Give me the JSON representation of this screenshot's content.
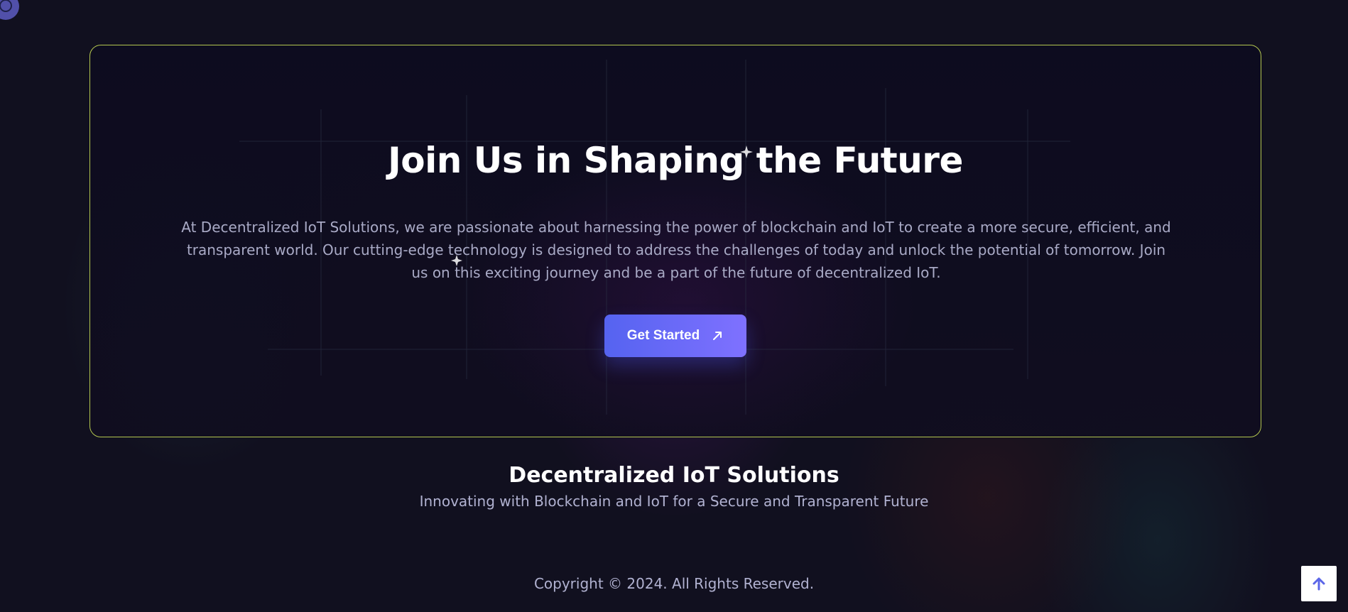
{
  "cta": {
    "title": "Join Us in Shaping the Future",
    "description": "At Decentralized IoT Solutions, we are passionate about harnessing the power of blockchain and IoT to create a more secure, efficient, and transparent world. Our cutting-edge technology is designed to address the challenges of today and unlock the potential of tomorrow. Join us on this exciting journey and be a part of the future of decentralized IoT.",
    "button_label": "Get Started",
    "button_icon": "arrow-up-right-icon"
  },
  "footer": {
    "brand_title": "Decentralized IoT Solutions",
    "brand_subtitle": "Innovating with Blockchain and IoT for a Secure and Transparent Future",
    "copyright": "Copyright © 2024. All Rights Reserved."
  },
  "scroll_top": {
    "icon": "arrow-up-icon"
  },
  "colors": {
    "background": "#11101f",
    "box_border": "#b3c64f",
    "button_start": "#5563f0",
    "button_end": "#7f71ff",
    "muted_text": "#a9aac6"
  }
}
